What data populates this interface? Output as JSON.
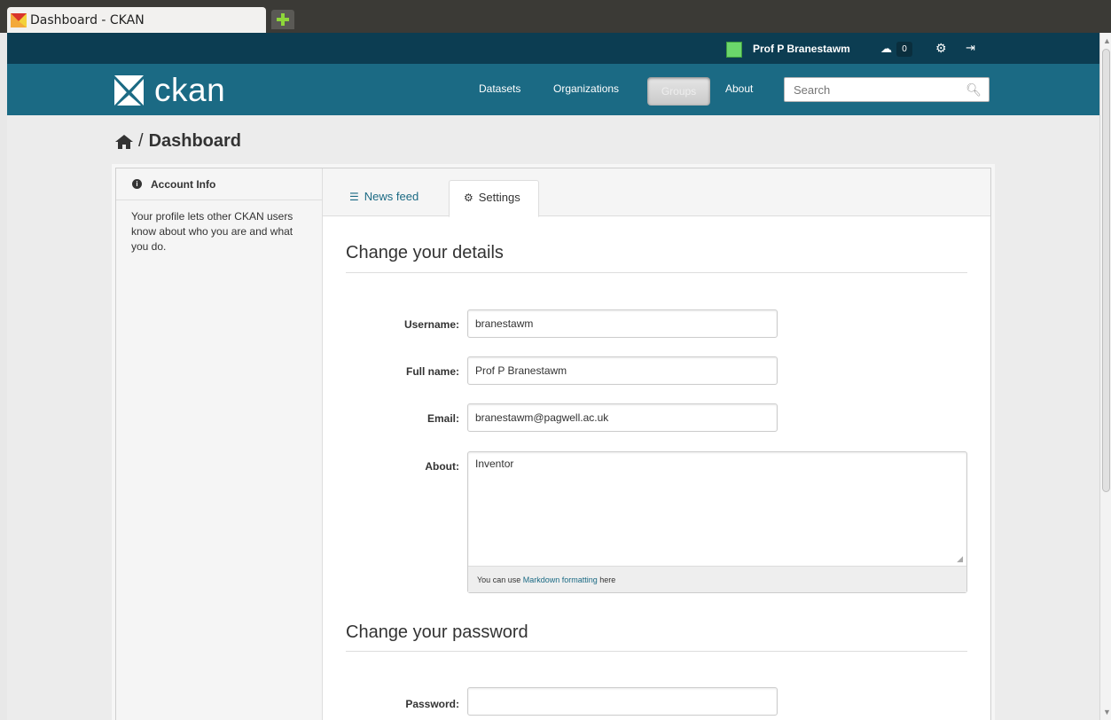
{
  "browser": {
    "tab_title": "Dashboard - CKAN"
  },
  "account": {
    "user_name": "Prof P Branestawm",
    "dashboard_count": "0"
  },
  "masthead": {
    "logo_text": "ckan",
    "nav": [
      "Datasets",
      "Organizations",
      "Groups",
      "About"
    ],
    "search_placeholder": "Search"
  },
  "breadcrumb": {
    "separator": "/",
    "current": "Dashboard"
  },
  "sidebar": {
    "title": "Account Info",
    "text": "Your profile lets other CKAN users know about who you are and what you do."
  },
  "tabs": {
    "news_feed": "News feed",
    "settings": "Settings"
  },
  "form": {
    "details_title": "Change your details",
    "username_label": "Username:",
    "username_value": "branestawm",
    "fullname_label": "Full name:",
    "fullname_value": "Prof P Branestawm",
    "email_label": "Email:",
    "email_value": "branestawm@pagwell.ac.uk",
    "about_label": "About:",
    "about_value": "Inventor",
    "help_prefix": "You can use",
    "help_link": "Markdown formatting",
    "help_suffix": "here",
    "password_title": "Change your password",
    "password_label": "Password:",
    "password_value": ""
  },
  "colors": {
    "account_bar": "#0c3d52",
    "masthead": "#1b6a84",
    "link": "#1b6a84"
  }
}
